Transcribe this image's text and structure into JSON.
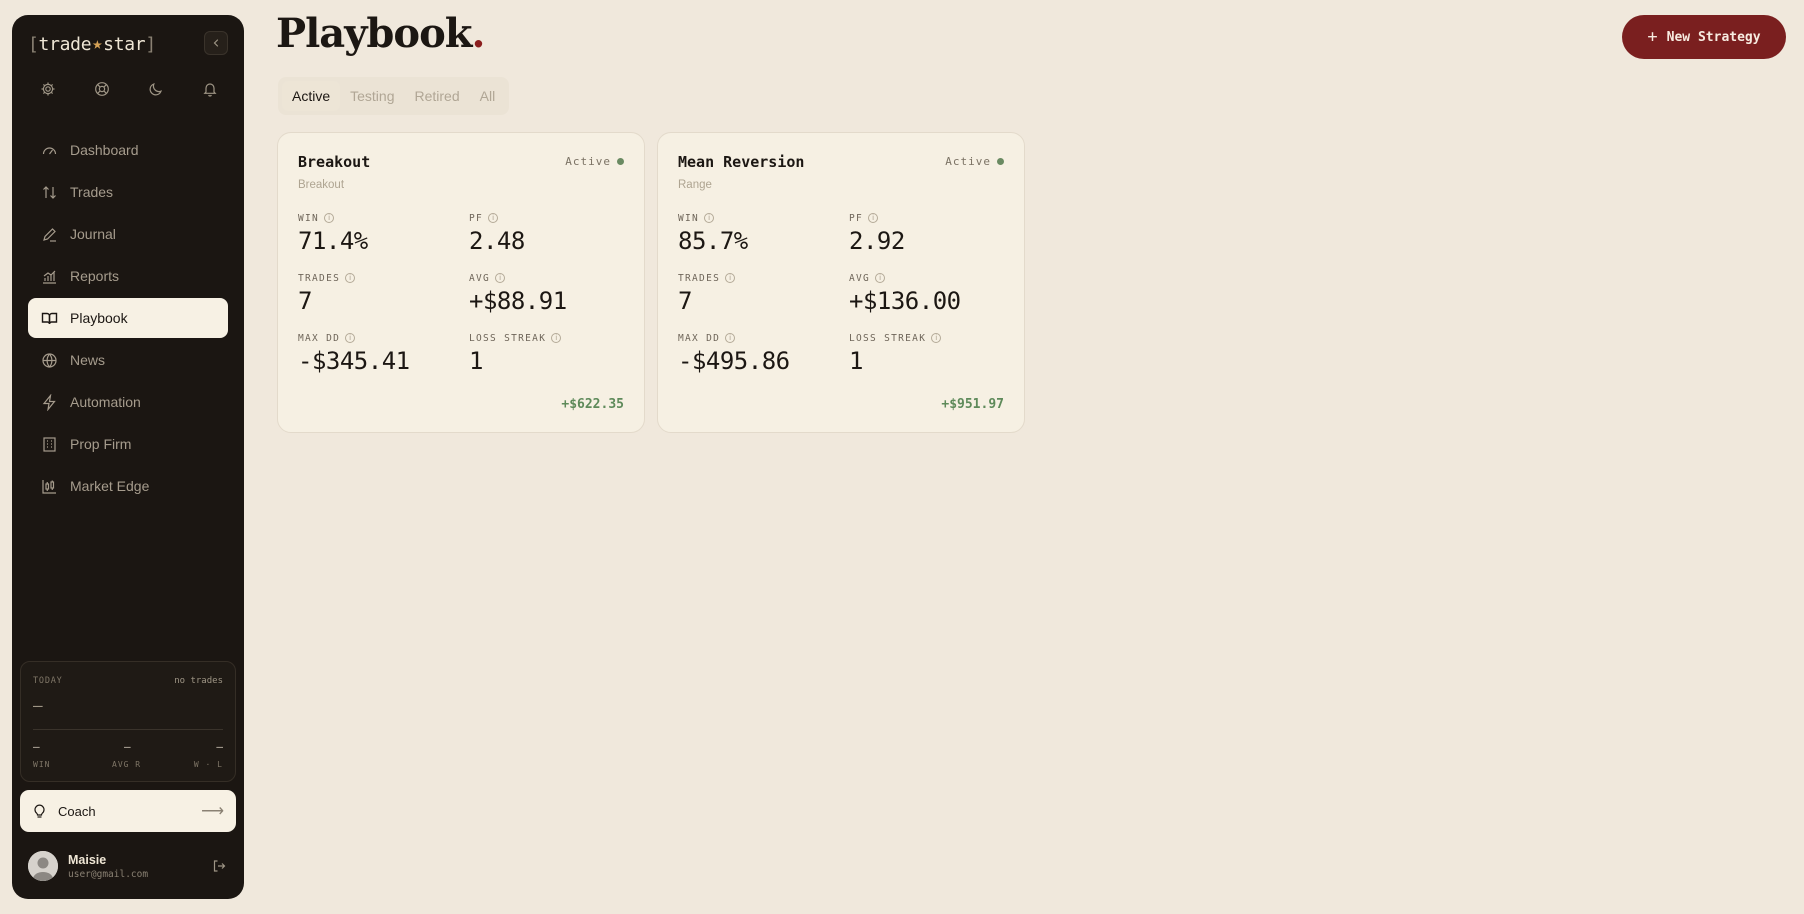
{
  "sidebar": {
    "logo": {
      "left": "[",
      "word1": "trade",
      "star": "★",
      "word2": "star",
      "right": "]"
    },
    "nav": [
      {
        "label": "Dashboard",
        "icon": "gauge-icon"
      },
      {
        "label": "Trades",
        "icon": "arrows-up-down-icon"
      },
      {
        "label": "Journal",
        "icon": "pen-icon"
      },
      {
        "label": "Reports",
        "icon": "bar-chart-icon"
      },
      {
        "label": "Playbook",
        "icon": "book-open-icon",
        "active": true
      },
      {
        "label": "News",
        "icon": "globe-icon"
      },
      {
        "label": "Automation",
        "icon": "lightning-icon"
      },
      {
        "label": "Prop Firm",
        "icon": "building-icon"
      },
      {
        "label": "Market Edge",
        "icon": "candlestick-icon"
      }
    ],
    "today": {
      "label": "TODAY",
      "status": "no trades",
      "value": "—",
      "win_value": "—",
      "avg_r_value": "—",
      "wl_value": "—",
      "win_label": "WIN",
      "avg_r_label": "AVG R",
      "wl_label": "W · L"
    },
    "coach": {
      "label": "Coach",
      "arrow": "⟶"
    },
    "user": {
      "name": "Maisie",
      "email": "user@gmail.com"
    }
  },
  "header": {
    "title": "Playbook",
    "title_dot": ".",
    "new_button": {
      "plus": "+",
      "label": "New Strategy"
    }
  },
  "tabs": [
    "Active",
    "Testing",
    "Retired",
    "All"
  ],
  "active_tab": "Active",
  "labels": {
    "win": "WIN",
    "pf": "PF",
    "trades": "TRADES",
    "avg": "AVG",
    "max_dd": "MAX DD",
    "loss_streak": "LOSS STREAK",
    "info": "i"
  },
  "strategies": [
    {
      "name": "Breakout",
      "category": "Breakout",
      "status": "Active",
      "win": "71.4%",
      "pf": "2.48",
      "trades": "7",
      "avg": "+$88.91",
      "max_dd": "-$345.41",
      "loss_streak": "1",
      "total": "+$622.35"
    },
    {
      "name": "Mean Reversion",
      "category": "Range",
      "status": "Active",
      "win": "85.7%",
      "pf": "2.92",
      "trades": "7",
      "avg": "+$136.00",
      "max_dd": "-$495.86",
      "loss_streak": "1",
      "total": "+$951.97"
    }
  ],
  "colors": {
    "background": "#f0e8dc",
    "sidebar": "#1b1612",
    "accent": "#7a1f1f",
    "positive": "#5e8a5a",
    "status_dot": "#6a8a62"
  }
}
